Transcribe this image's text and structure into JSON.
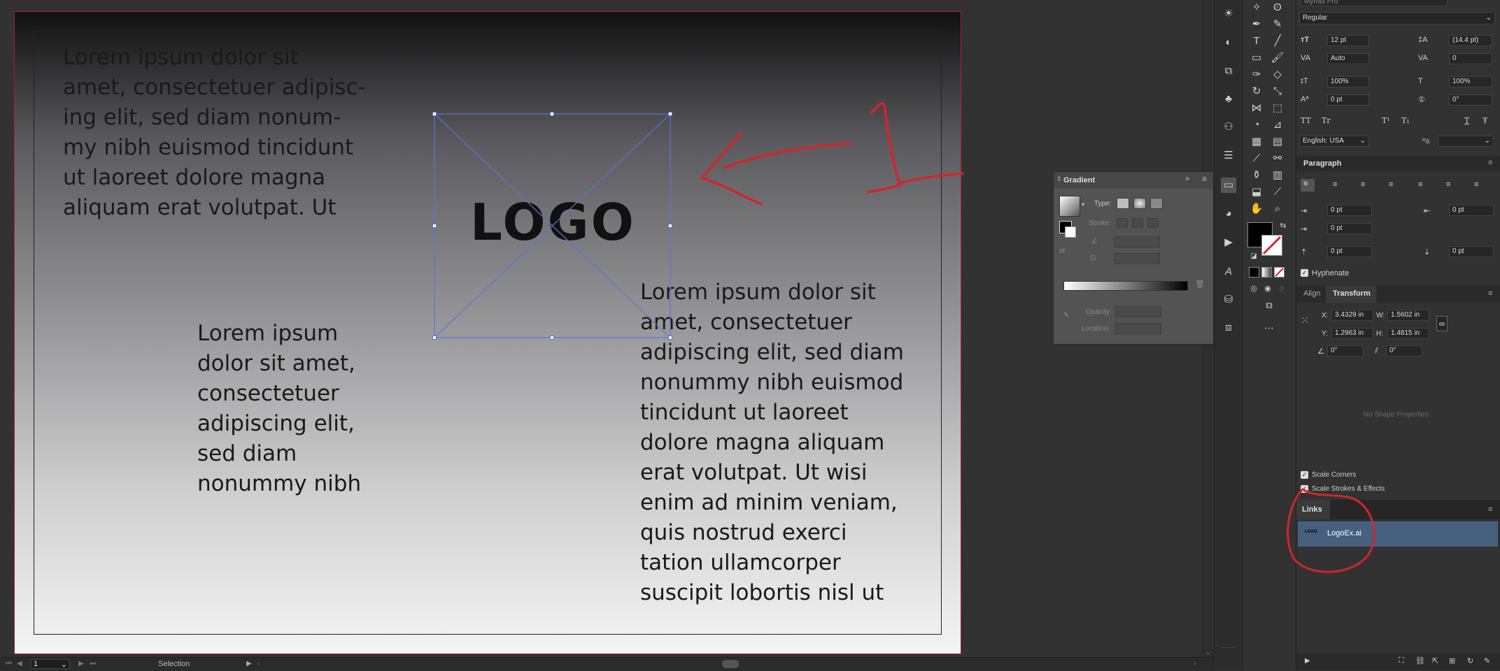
{
  "canvas": {
    "text_block_1": "Lorem ipsum dolor sit\namet, consectetuer adipisc-\ning elit, sed diam nonum-\nmy nibh euismod tincidunt\nut laoreet dolore magna\naliquam erat volutpat. Ut",
    "text_block_2": "Lorem ipsum\ndolor sit amet,\nconsectetuer\nadipiscing elit,\nsed diam\nnonummy nibh",
    "text_block_3": "Lorem ipsum dolor sit\namet, consectetuer\nadipiscing elit, sed diam\nnonummy nibh euismod\ntincidunt ut laoreet\ndolore magna aliquam\nerat volutpat. Ut wisi\nenim ad minim veniam,\nquis nostrud exerci\ntation ullamcorper\nsuscipit lobortis nisl ut",
    "logo_text": "LOGO"
  },
  "statusbar": {
    "page_number": "1",
    "status_label": "Selection"
  },
  "gradient_panel": {
    "title": "Gradient",
    "type_label": "Type:",
    "stroke_label": "Stroke:",
    "opacity_label": "Opacity:",
    "location_label": "Location:"
  },
  "character": {
    "font_family": "Myriad Pro",
    "font_style": "Regular",
    "font_size": "12 pt",
    "leading": "(14.4 pt)",
    "kerning": "Auto",
    "tracking": "0",
    "vertical_scale": "100%",
    "horizontal_scale": "100%",
    "baseline_shift": "0 pt",
    "rotation": "0°",
    "caps_all": "TT",
    "caps_small": "Tr",
    "superscript": "T¹",
    "subscript": "T₁",
    "underline": "T",
    "strikethrough": "Ŧ",
    "language": "English: USA",
    "aa_label": "ªa"
  },
  "paragraph": {
    "tab": "Paragraph",
    "indent_left": "0 pt",
    "indent_right": "0 pt",
    "space_first": "0 pt",
    "space_before": "0 pt",
    "space_after": "0 pt",
    "hyphenate_label": "Hyphenate"
  },
  "transform": {
    "tab_align": "Align",
    "tab_transform": "Transform",
    "x_label": "X:",
    "x": "3.4329 in",
    "y_label": "Y:",
    "y": "1.2963 in",
    "w_label": "W:",
    "w": "1.5602 in",
    "h_label": "H:",
    "h": "1.4815 in",
    "rotate": "0°",
    "shear": "0°",
    "no_shape": "No Shape Properties",
    "scale_corners": "Scale Corners",
    "scale_strokes": "Scale Strokes & Effects"
  },
  "links": {
    "tab": "Links",
    "thumb_text": "LOGO",
    "file_name": "LogoEx.ai"
  },
  "colors": {
    "accent_selection": "#5a74d6",
    "artboard_border": "#b0202a",
    "annotation_red": "#d0262a",
    "links_highlight": "#46607f"
  },
  "icons": [
    "sun-icon",
    "circle-half-icon",
    "transform-icon",
    "club-icon",
    "brush-icon",
    "layers-icon",
    "gradient-panel-icon",
    "appearance-icon",
    "play-icon",
    "type-a-icon",
    "clone-icon",
    "links-panel-icon",
    "selection-arrow-icon",
    "pen-tool-icon",
    "type-tool-icon",
    "line-tool-icon",
    "rectangle-tool-icon",
    "paintbrush-icon",
    "eraser-icon",
    "rotate-tool-icon",
    "hand-tool-icon",
    "zoom-tool-icon",
    "eyedropper-icon",
    "more-icon"
  ]
}
